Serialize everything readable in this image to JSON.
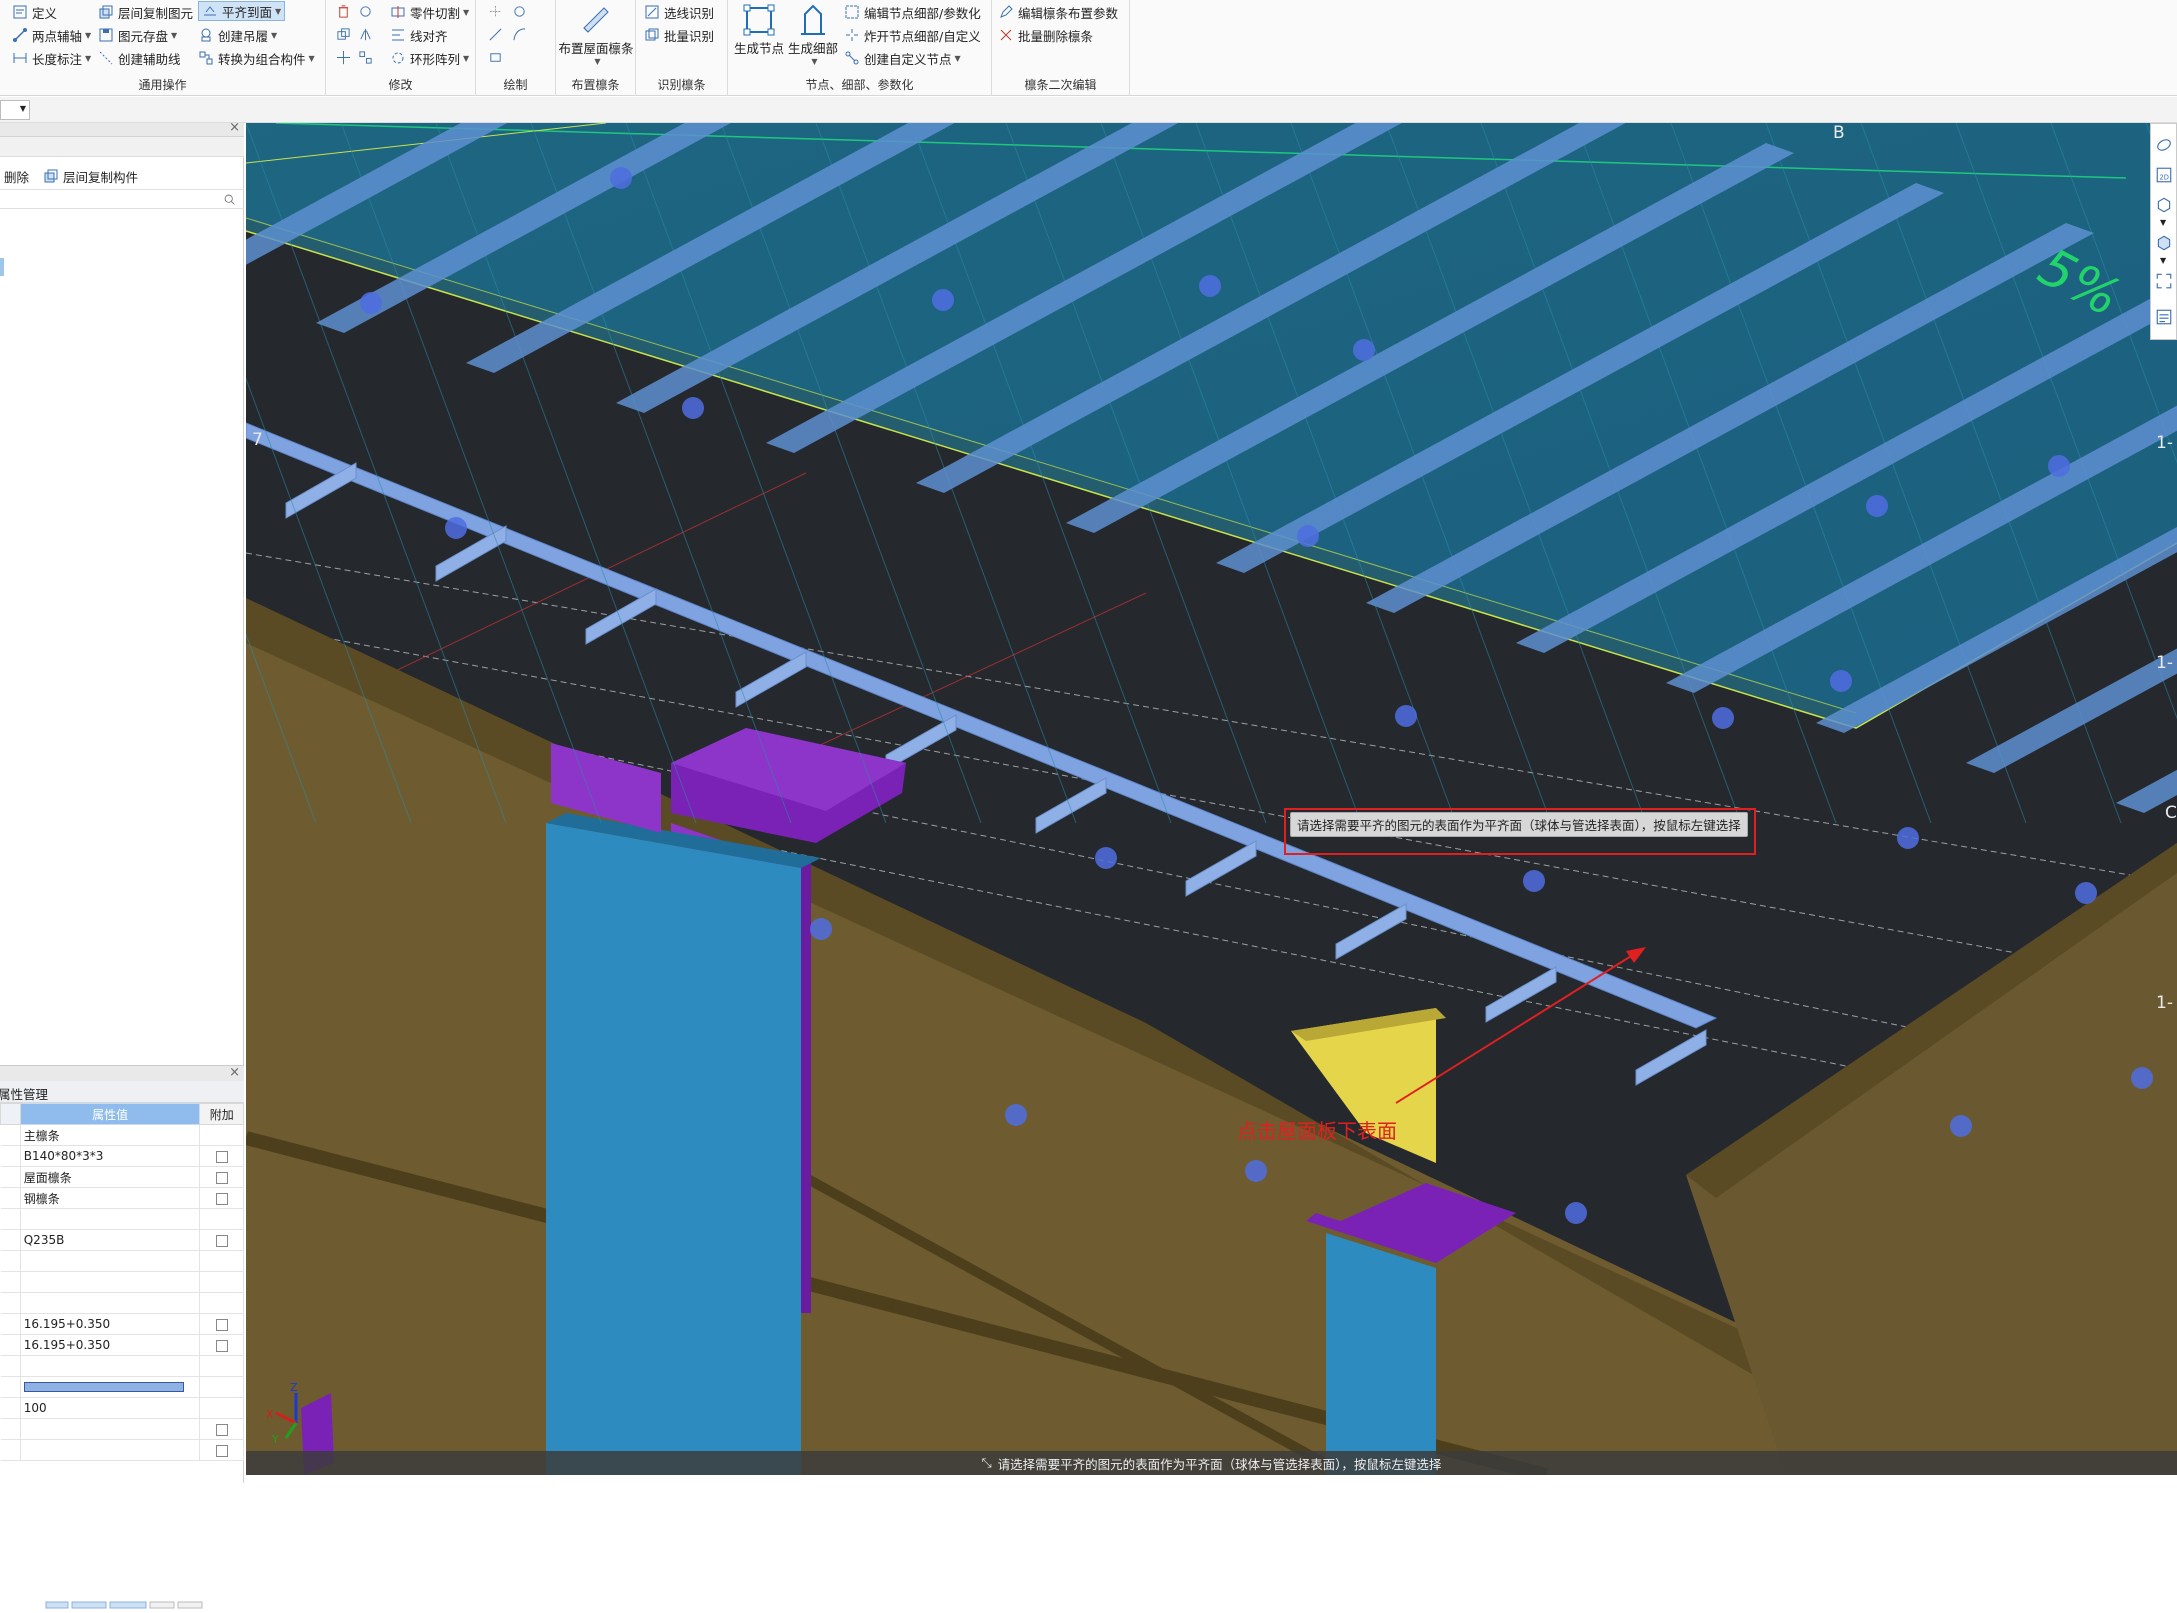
{
  "ribbon": {
    "groups": [
      {
        "title": "通用操作",
        "items": [
          {
            "label": "定义"
          },
          {
            "label": "层间复制图元"
          },
          {
            "label": "平齐到面"
          },
          {
            "label": "两点辅轴"
          },
          {
            "label": "图元存盘"
          },
          {
            "label": "创建吊履"
          },
          {
            "label": "长度标注"
          },
          {
            "label": "创建辅助线"
          },
          {
            "label": "转换为组合构件"
          }
        ]
      },
      {
        "title": "修改",
        "items": [
          {
            "label": "零件切割"
          },
          {
            "label": "线对齐"
          },
          {
            "label": "环形阵列"
          }
        ]
      },
      {
        "title": "绘制"
      },
      {
        "title": "布置檩条",
        "big": "布置屋面檩条"
      },
      {
        "title": "识别檩条",
        "items": [
          {
            "label": "选线识别"
          },
          {
            "label": "批量识别"
          }
        ]
      },
      {
        "title": "节点、细部、参数化",
        "items": [
          {
            "label": "生成节点"
          },
          {
            "label": "生成细部"
          },
          {
            "label": "编辑节点细部/参数化"
          },
          {
            "label": "炸开节点细部/自定义"
          },
          {
            "label": "创建自定义节点"
          }
        ]
      },
      {
        "title": "檩条二次编辑",
        "items": [
          {
            "label": "编辑檩条布置参数"
          },
          {
            "label": "批量删除檩条"
          }
        ]
      }
    ]
  },
  "left_panel": {
    "toolbar": {
      "delete": "删除",
      "copy_floor": "层间复制构件"
    },
    "props_tab": "属性管理",
    "table_head": {
      "value": "属性值",
      "extra": "附加"
    },
    "rows": [
      {
        "value": "主檩条",
        "check": false,
        "has_check": false
      },
      {
        "value": "B140*80*3*3",
        "has_check": true
      },
      {
        "value": "屋面檩条",
        "has_check": true
      },
      {
        "value": "钢檩条",
        "has_check": true
      },
      {
        "value": "",
        "has_check": false
      },
      {
        "value": "Q235B",
        "has_check": true
      },
      {
        "value": "",
        "has_check": false
      },
      {
        "value": "",
        "has_check": false
      },
      {
        "value": "",
        "has_check": false
      },
      {
        "value": "16.195+0.350",
        "has_check": true
      },
      {
        "value": "16.195+0.350",
        "has_check": true
      },
      {
        "value": "",
        "has_check": false
      },
      {
        "value": "",
        "has_check": false,
        "color_bar": "#8fb2e6"
      },
      {
        "value": "100",
        "has_check": false
      },
      {
        "value": "",
        "has_check": true
      },
      {
        "value": "",
        "has_check": true
      }
    ]
  },
  "viewport": {
    "tooltip": "请选择需要平齐的图元的表面作为平齐面（球体与管选择表面），按鼠标左键选择",
    "annotation": "点击屋面板下表面",
    "status": "请选择需要平齐的图元的表面作为平齐面（球体与管选择表面），按鼠标左键选择",
    "labels": {
      "axis_b": "B",
      "axis_7": "7",
      "axis_c": "C",
      "right_1a": "1-",
      "right_1b": "1-",
      "right_1c": "1-",
      "slope": "5%"
    },
    "colors": {
      "panel": "#1f6f8e",
      "purlin": "#7fa3e0",
      "wall": "#6e5c30",
      "column": "#2e8bc0",
      "plate": "#7a22b6",
      "yellow": "#e5d54a"
    }
  }
}
